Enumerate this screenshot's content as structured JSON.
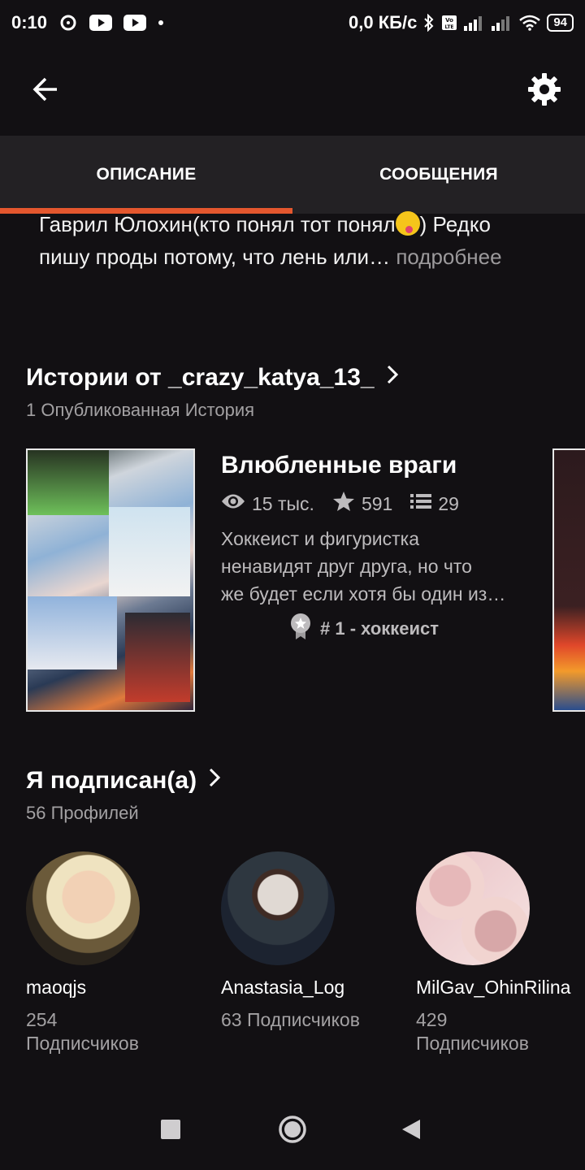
{
  "status_bar": {
    "time": "0:10",
    "network_speed": "0,0 КБ/с",
    "battery": "94"
  },
  "tabs": [
    {
      "label": "ОПИСАНИЕ"
    },
    {
      "label": "СООБЩЕНИЯ"
    }
  ],
  "description": {
    "line1": "Гаврил Юлохин(кто понял тот понял",
    "line1_end": ") Редко",
    "line2": "пишу проды потому, что лень или…",
    "more": "подробнее"
  },
  "stories_section": {
    "title": "Истории от _crazy_katya_13_",
    "subtitle": "1 Опубликованная История"
  },
  "story": {
    "title": "Влюбленные враги",
    "views": "15 тыс.",
    "votes": "591",
    "parts": "29",
    "desc_line1": "Хоккеист и фигуристка",
    "desc_line2": "ненавидят друг друга, но что",
    "desc_line3": "же будет если хотя бы один из…",
    "rank": "# 1 - хоккеист"
  },
  "following_section": {
    "title": "Я подписан(а)",
    "subtitle": "56 Профилей"
  },
  "profiles": [
    {
      "name": "maoqjs",
      "followers_line1": "254",
      "followers_line2": "Подписчиков"
    },
    {
      "name": "Anastasia_Log",
      "followers_line1": "63 Подписчиков",
      "followers_line2": ""
    },
    {
      "name": "MilGav_OhinRilina",
      "followers_line1": "429",
      "followers_line2": "Подписчиков"
    }
  ],
  "colors": {
    "background": "#121013",
    "accent": "#e4572e",
    "tab_bar": "#232124",
    "muted_text": "#a3a1a3"
  },
  "icons": {
    "back": "arrow-left-icon",
    "settings": "gear-icon",
    "views": "eye-icon",
    "votes": "star-icon",
    "parts": "list-icon",
    "rank": "medal-icon"
  }
}
